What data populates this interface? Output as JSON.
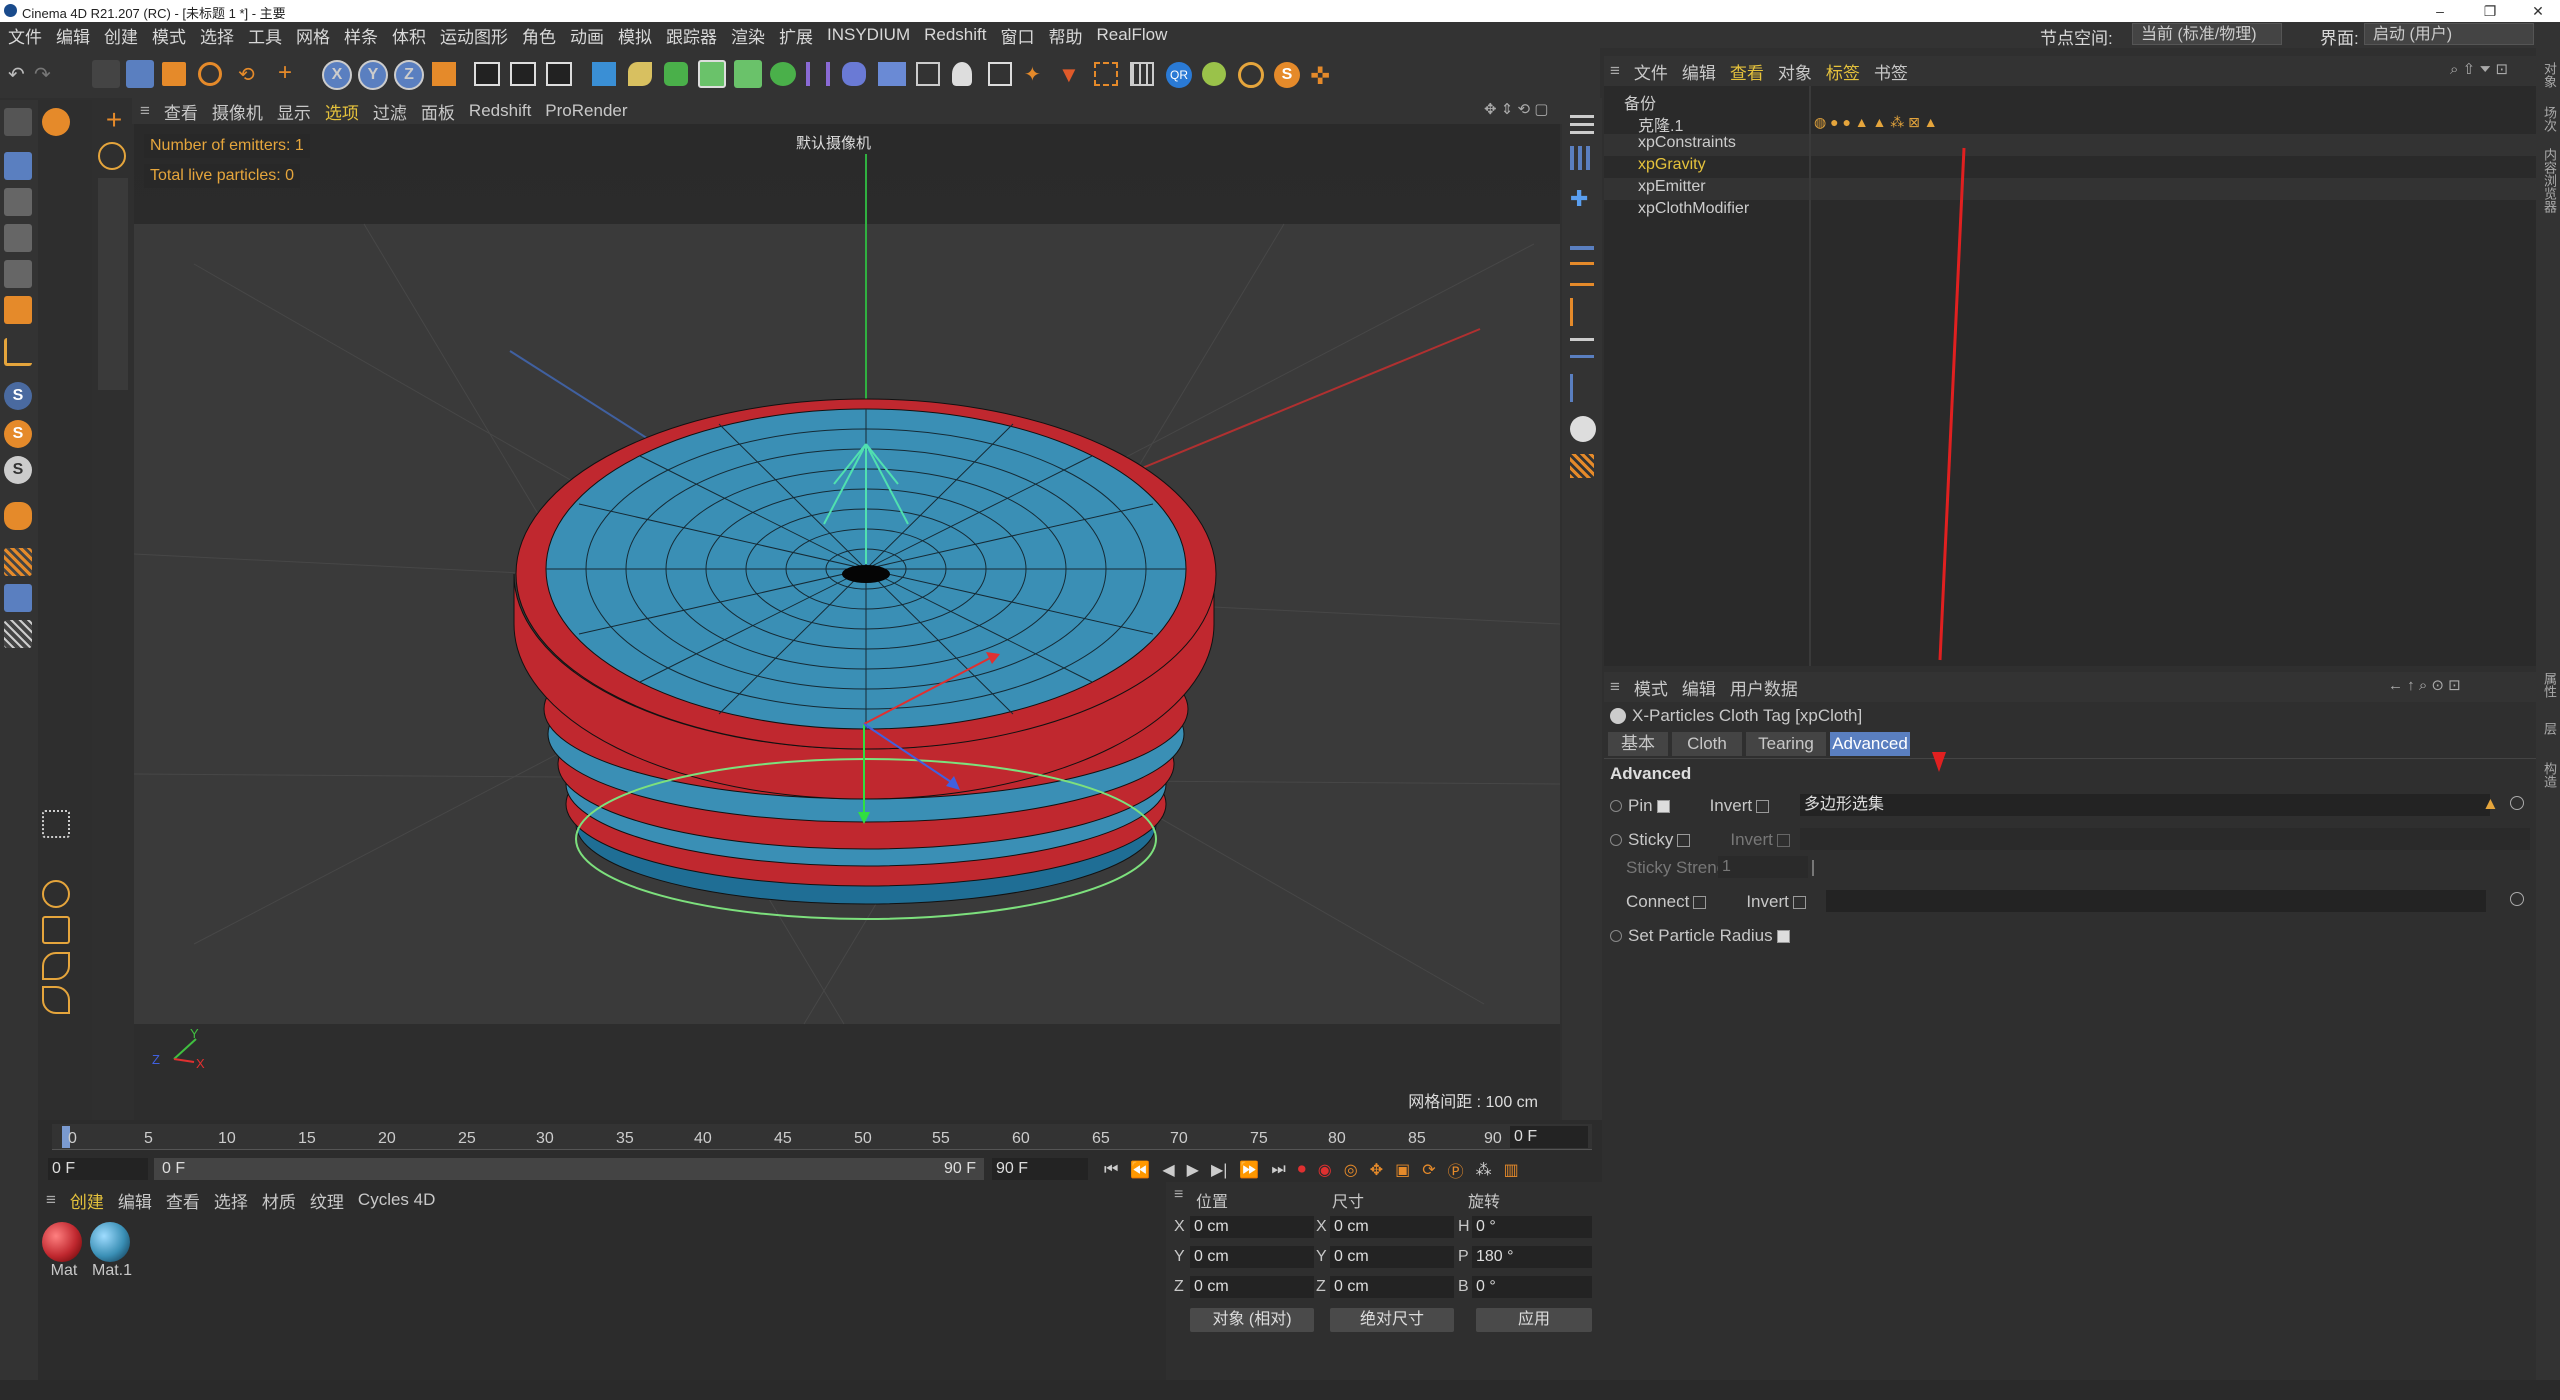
{
  "title_bar": {
    "text": "Cinema 4D R21.207 (RC) - [未标题 1 *] - 主要"
  },
  "menu": [
    "文件",
    "编辑",
    "创建",
    "模式",
    "选择",
    "工具",
    "网格",
    "样条",
    "体积",
    "运动图形",
    "角色",
    "动画",
    "模拟",
    "跟踪器",
    "渲染",
    "扩展",
    "INSYDIUM",
    "Redshift",
    "窗口",
    "帮助",
    "RealFlow"
  ],
  "node_space": {
    "label": "节点空间:",
    "value": "当前 (标准/物理)"
  },
  "interface": {
    "label": "界面:",
    "value": "启动 (用户)"
  },
  "viewport_menu": [
    "查看",
    "摄像机",
    "显示",
    "选项",
    "过滤",
    "面板",
    "Redshift",
    "ProRender"
  ],
  "viewport": {
    "hud_emitters": "Number of emitters: 1",
    "hud_particles": "Total live particles: 0",
    "camera_label": "默认摄像机",
    "grid_spacing": "网格间距 : 100 cm",
    "colors": {
      "top_face": "#3a8fb5",
      "ring": "#c0282f",
      "wire": "#111111"
    }
  },
  "timeline": {
    "ticks": [
      "0",
      "5",
      "10",
      "15",
      "20",
      "25",
      "30",
      "35",
      "40",
      "45",
      "50",
      "55",
      "60",
      "65",
      "70",
      "75",
      "80",
      "85",
      "90"
    ],
    "current_frame": "0 F",
    "start": "0 F",
    "range_start": "0 F",
    "range_end": "90 F",
    "end": "90 F"
  },
  "material_menu": [
    "创建",
    "编辑",
    "查看",
    "选择",
    "材质",
    "纹理",
    "Cycles 4D"
  ],
  "materials": [
    {
      "name": "Mat",
      "color": "#c0282f"
    },
    {
      "name": "Mat.1",
      "color": "#3a8fb5"
    }
  ],
  "coords": {
    "headers": [
      "位置",
      "尺寸",
      "旋转"
    ],
    "rows": [
      {
        "axis": "X",
        "pos": "0 cm",
        "size_axis": "X",
        "size": "0 cm",
        "rot_axis": "H",
        "rot": "0 °"
      },
      {
        "axis": "Y",
        "pos": "0 cm",
        "size_axis": "Y",
        "size": "0 cm",
        "rot_axis": "P",
        "rot": "180 °"
      },
      {
        "axis": "Z",
        "pos": "0 cm",
        "size_axis": "Z",
        "size": "0 cm",
        "rot_axis": "B",
        "rot": "0 °"
      }
    ],
    "mode": "对象 (相对)",
    "size_mode": "绝对尺寸",
    "apply": "应用"
  },
  "object_menu": [
    "文件",
    "编辑",
    "查看",
    "对象",
    "标签",
    "书签"
  ],
  "objects": [
    {
      "name": "备份",
      "highlight": false
    },
    {
      "name": "克隆.1",
      "highlight": false
    },
    {
      "name": "xpConstraints",
      "highlight": false
    },
    {
      "name": "xpGravity",
      "highlight": true
    },
    {
      "name": "xpEmitter",
      "highlight": false
    },
    {
      "name": "xpClothModifier",
      "highlight": false
    }
  ],
  "attr_menu": [
    "模式",
    "编辑",
    "用户数据"
  ],
  "attr": {
    "title": "X-Particles Cloth Tag [xpCloth]",
    "tabs": [
      "基本",
      "Cloth",
      "Tearing",
      "Advanced"
    ],
    "active_tab": "Advanced",
    "section": "Advanced",
    "pin_label": "Pin",
    "invert_label": "Invert",
    "pin_value": "多边形选集",
    "sticky_label": "Sticky",
    "sticky_strength_label": "Sticky Strength",
    "sticky_strength_value": "1",
    "connect_label": "Connect",
    "set_radius_label": "Set Particle Radius"
  },
  "right_edge_tabs": [
    "对象",
    "场次",
    "内容浏览器",
    "属性",
    "层",
    "构造"
  ],
  "colors": {
    "accent_active": "#5a7fc0",
    "hud_text": "#e5a53c",
    "gravity_text": "#e5c23c",
    "arrow": "#e02020"
  }
}
